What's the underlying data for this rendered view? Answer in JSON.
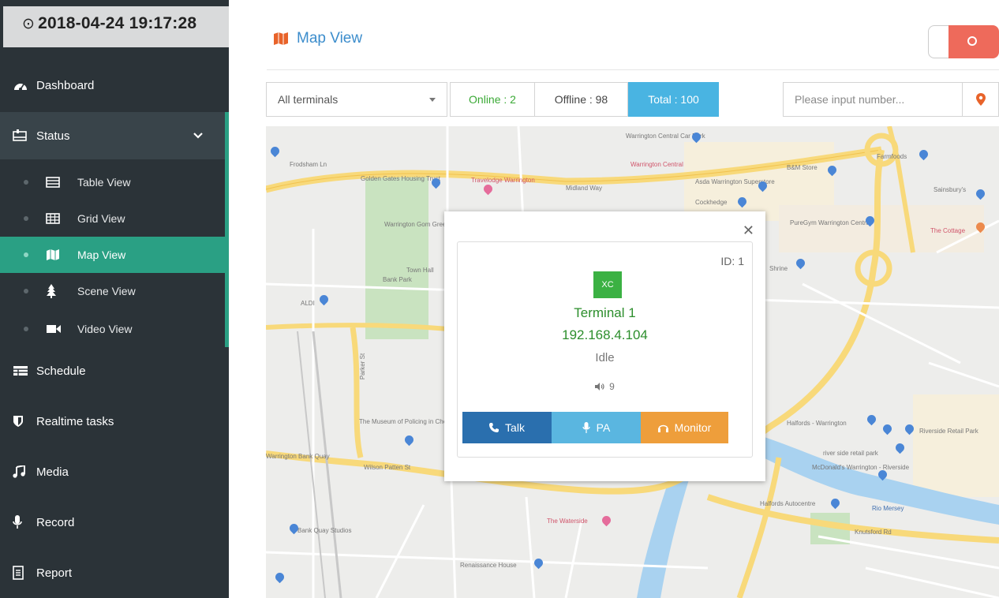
{
  "sidebar": {
    "datetime": "2018-04-24 19:17:28",
    "items": [
      {
        "label": "Dashboard",
        "icon": "dashboard-icon"
      },
      {
        "label": "Status",
        "icon": "status-icon"
      },
      {
        "label": "Schedule",
        "icon": "schedule-icon"
      },
      {
        "label": "Realtime tasks",
        "icon": "shield-icon"
      },
      {
        "label": "Media",
        "icon": "music-icon"
      },
      {
        "label": "Record",
        "icon": "microphone-icon"
      },
      {
        "label": "Report",
        "icon": "report-icon"
      }
    ],
    "subitems": [
      {
        "label": "Table View",
        "icon": "table-icon"
      },
      {
        "label": "Grid View",
        "icon": "grid-icon"
      },
      {
        "label": "Map View",
        "icon": "map-icon"
      },
      {
        "label": "Scene View",
        "icon": "tree-icon"
      },
      {
        "label": "Video View",
        "icon": "video-icon"
      }
    ],
    "active_subitem": "Map View"
  },
  "header": {
    "title": "Map View",
    "toggle_state": "on"
  },
  "filters": {
    "terminal_select": "All terminals",
    "online": "Online : 2",
    "offline": "Offline : 98",
    "total": "Total : 100",
    "search_placeholder": "Please input number..."
  },
  "map": {
    "labels": [
      "Warrington Central Car Park",
      "Warrington Central",
      "Frodsham Ln",
      "Golden Gates Housing Trust",
      "Travelodge Warrington",
      "Midland Way",
      "Asda Warrington Superstore",
      "Cockhedge",
      "B&M Store",
      "Farmfoods",
      "Sainsbury's",
      "PureGym Warrington Central",
      "The Cottage",
      "Warrington Gom Green & Magist",
      "Town Hall",
      "Bank Park",
      "Shrine",
      "ALDI",
      "The Museum of Policing in Cheshire",
      "Warrington Bank Quay",
      "Wilson Patten St",
      "Parker St",
      "Halfords - Warrington",
      "Riverside Retail Park",
      "river side retail park",
      "McDonald's Warrington - Riverside",
      "Halfords Autocentre",
      "Rio Mersey",
      "Knutsford Rd",
      "The Waterside",
      "Bank Quay Studios",
      "Renaissance House"
    ]
  },
  "popup": {
    "id_label": "ID: 1",
    "badge": "XC",
    "name": "Terminal 1",
    "ip": "192.168.4.104",
    "state": "Idle",
    "volume": "9",
    "buttons": {
      "talk": "Talk",
      "pa": "PA",
      "monitor": "Monitor"
    }
  },
  "colors": {
    "sidebar_bg": "#2b3338",
    "accent_green": "#2aa084",
    "total_blue": "#49b4e2",
    "talk_blue": "#2a6fae",
    "pa_blue": "#5ab6e0",
    "monitor_orange": "#ee9e3b",
    "toggle_red": "#ee6a5b"
  }
}
